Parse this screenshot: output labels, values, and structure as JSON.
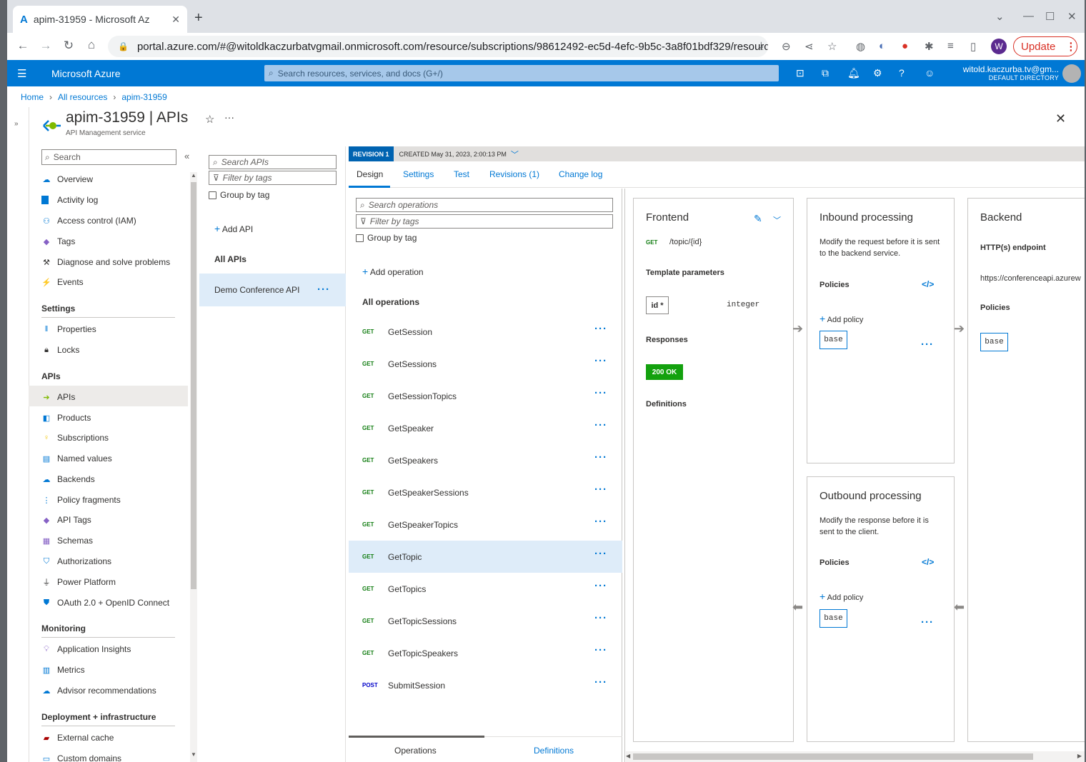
{
  "browser": {
    "tab_title": "apim-31959 - Microsoft Az",
    "url": "portal.azure.com/#@witoldkaczurbatvgmail.onmicrosoft.com/resource/subscriptions/98612492-ec5d-4efc-9b5c-3a8f01bdf329/resourc...",
    "profile_initial": "W",
    "update_label": "Update"
  },
  "azure": {
    "brand": "Microsoft Azure",
    "search_placeholder": "Search resources, services, and docs (G+/)",
    "user_name": "witold.kaczurba.tv@gm...",
    "directory": "DEFAULT DIRECTORY"
  },
  "breadcrumb": [
    "Home",
    "All resources",
    "apim-31959"
  ],
  "page": {
    "title": "apim-31959 | APIs",
    "subtitle": "API Management service"
  },
  "resource_menu": {
    "search_placeholder": "Search",
    "top_items": [
      "Overview",
      "Activity log",
      "Access control (IAM)",
      "Tags",
      "Diagnose and solve problems",
      "Events"
    ],
    "settings_heading": "Settings",
    "settings_items": [
      "Properties",
      "Locks"
    ],
    "apis_heading": "APIs",
    "apis_items": [
      "APIs",
      "Products",
      "Subscriptions",
      "Named values",
      "Backends",
      "Policy fragments",
      "API Tags",
      "Schemas",
      "Authorizations",
      "Power Platform",
      "OAuth 2.0 + OpenID Connect"
    ],
    "monitoring_heading": "Monitoring",
    "monitoring_items": [
      "Application Insights",
      "Metrics",
      "Advisor recommendations"
    ],
    "deployment_heading": "Deployment + infrastructure",
    "deployment_items": [
      "External cache",
      "Custom domains"
    ]
  },
  "api_list": {
    "search_placeholder": "Search APIs",
    "filter_placeholder": "Filter by tags",
    "group_by_tag": "Group by tag",
    "add_api": "Add API",
    "all_apis": "All APIs",
    "apis": [
      "Demo Conference API"
    ]
  },
  "revision": {
    "badge": "REVISION 1",
    "created": "CREATED May 31, 2023, 2:00:13 PM"
  },
  "tabs": [
    "Design",
    "Settings",
    "Test",
    "Revisions (1)",
    "Change log"
  ],
  "operations": {
    "search_placeholder": "Search operations",
    "filter_placeholder": "Filter by tags",
    "group_by_tag": "Group by tag",
    "add_operation": "Add operation",
    "all_operations": "All operations",
    "items": [
      {
        "method": "GET",
        "name": "GetSession"
      },
      {
        "method": "GET",
        "name": "GetSessions"
      },
      {
        "method": "GET",
        "name": "GetSessionTopics"
      },
      {
        "method": "GET",
        "name": "GetSpeaker"
      },
      {
        "method": "GET",
        "name": "GetSpeakers"
      },
      {
        "method": "GET",
        "name": "GetSpeakerSessions"
      },
      {
        "method": "GET",
        "name": "GetSpeakerTopics"
      },
      {
        "method": "GET",
        "name": "GetTopic"
      },
      {
        "method": "GET",
        "name": "GetTopics"
      },
      {
        "method": "GET",
        "name": "GetTopicSessions"
      },
      {
        "method": "GET",
        "name": "GetTopicSpeakers"
      },
      {
        "method": "POST",
        "name": "SubmitSession"
      }
    ],
    "selected": "GetTopic",
    "bottom_tabs": [
      "Operations",
      "Definitions"
    ]
  },
  "frontend": {
    "title": "Frontend",
    "method": "GET",
    "path": "/topic/{id}",
    "template_parameters": "Template parameters",
    "param_name": "id *",
    "param_type": "integer",
    "responses": "Responses",
    "response_code": "200 OK",
    "definitions": "Definitions"
  },
  "inbound": {
    "title": "Inbound processing",
    "description": "Modify the request before it is sent to the backend service.",
    "policies": "Policies",
    "add_policy": "Add policy",
    "base": "base"
  },
  "outbound": {
    "title": "Outbound processing",
    "description": "Modify the response before it is sent to the client.",
    "policies": "Policies",
    "add_policy": "Add policy",
    "base": "base"
  },
  "backend": {
    "title": "Backend",
    "endpoint_label": "HTTP(s) endpoint",
    "endpoint_url": "https://conferenceapi.azurew",
    "policies": "Policies",
    "base": "base"
  }
}
